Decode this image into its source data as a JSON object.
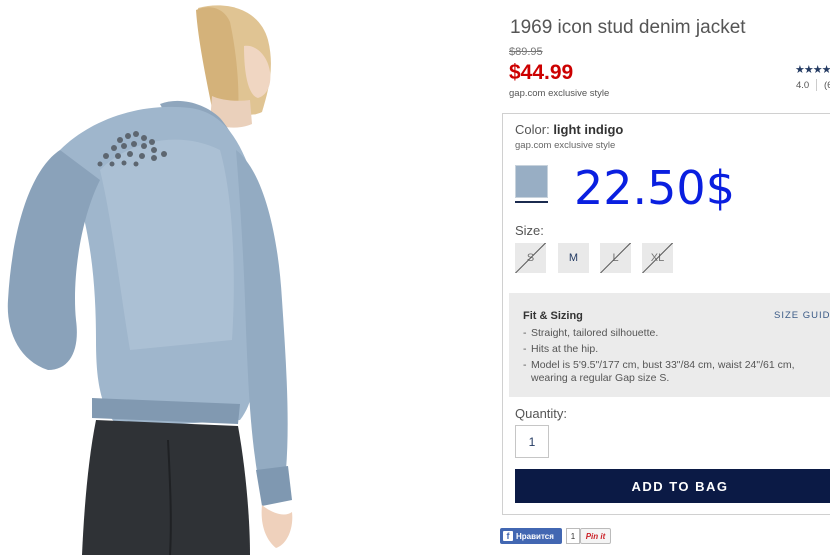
{
  "product": {
    "title": "1969 icon stud denim jacket",
    "old_price": "$89.95",
    "sale_price": "$44.99",
    "exclusive_note": "gap.com exclusive style",
    "rating": {
      "stars_text": "★★★★",
      "stars_value": 4.0,
      "value": "4.0",
      "count_partial": "(6"
    }
  },
  "color": {
    "label": "Color:",
    "value": "light indigo",
    "note": "gap.com exclusive style",
    "swatch_color": "#98aec4"
  },
  "overlay_price": "22.50$",
  "size": {
    "label": "Size:",
    "options": [
      {
        "label": "S",
        "available": false
      },
      {
        "label": "M",
        "available": true
      },
      {
        "label": "L",
        "available": false
      },
      {
        "label": "XL",
        "available": false
      }
    ]
  },
  "fit": {
    "title": "Fit & Sizing",
    "guide_link": "SIZE GUID",
    "bullets": [
      "Straight, tailored silhouette.",
      "Hits at the hip.",
      "Model is 5'9.5\"/177 cm, bust 33\"/84 cm, waist 24\"/61 cm, wearing a regular Gap size S."
    ]
  },
  "quantity": {
    "label": "Quantity:",
    "value": "1"
  },
  "add_to_bag": "ADD TO BAG",
  "social": {
    "fb_label": "Нравится",
    "fb_count": "1",
    "pin_label": "Pin it"
  },
  "colors": {
    "accent_red": "#cc0000",
    "navy": "#0b1a45",
    "overlay_blue": "#0a1fe0"
  }
}
